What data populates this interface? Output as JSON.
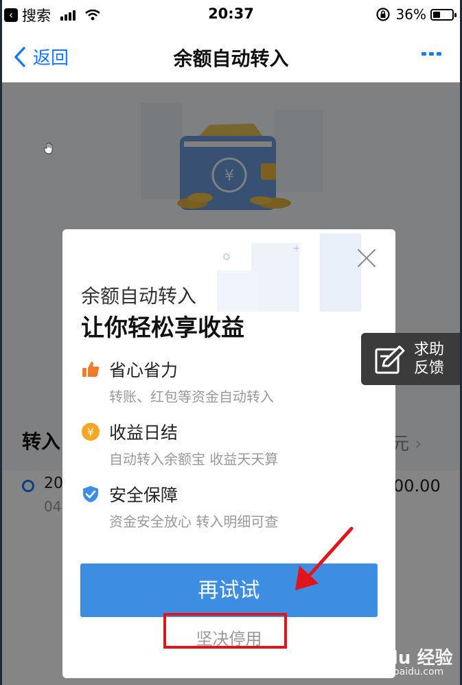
{
  "status_bar": {
    "back_app": "搜索",
    "time": "20:37",
    "battery": "36%"
  },
  "nav": {
    "back_label": "返回",
    "title": "余额自动转入"
  },
  "background": {
    "section_label": "转入",
    "section_amount_partial": "元",
    "row_text_1": "20",
    "row_text_2": "04",
    "row_amount_partial": "00.00"
  },
  "dialog": {
    "subtitle": "余额自动转入",
    "title": "让你轻松享收益",
    "features": [
      {
        "icon": "thumbs-up-icon",
        "title": "省心省力",
        "desc": "转账、红包等资金自动转入",
        "color": "#f07b2c"
      },
      {
        "icon": "yuan-coin-icon",
        "title": "收益日结",
        "desc": "自动转入余额宝 收益天天算",
        "color": "#f5a623"
      },
      {
        "icon": "shield-check-icon",
        "title": "安全保障",
        "desc": "资金安全放心 转入明细可查",
        "color": "#3d8ee3"
      }
    ],
    "primary_button": "再试试",
    "secondary_button": "坚决停用"
  },
  "help_float": {
    "label": "求助\n反馈"
  },
  "watermark": {
    "main": "Baidu 经验",
    "sub": "jingyan.baidu.com"
  },
  "colors": {
    "accent": "#1677ff",
    "primary_button": "#3d8ee3",
    "annotation": "#e2141b"
  }
}
